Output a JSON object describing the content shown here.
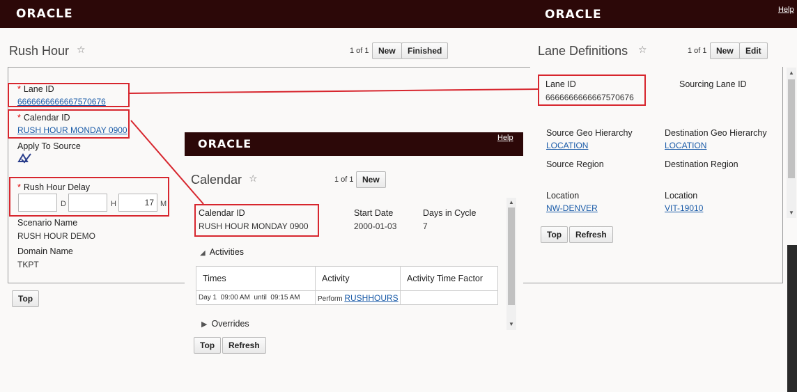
{
  "brand": {
    "logo_left": "ORACLE",
    "logo_right": "ORACLE",
    "help": "Help"
  },
  "rush_hour": {
    "title": "Rush Hour",
    "pager": "1 of 1",
    "new_label": "New",
    "finished_label": "Finished",
    "lane_id_label": "Lane ID",
    "lane_id_value": "6666666666667570676",
    "calendar_id_label": "Calendar ID",
    "calendar_id_value": "RUSH HOUR MONDAY 0900",
    "apply_to_source_label": "Apply To Source",
    "rush_hour_delay_label": "Rush Hour Delay",
    "delay_days": "",
    "delay_hours": "",
    "delay_minutes": "17",
    "unit_d": "D",
    "unit_h": "H",
    "unit_m": "M",
    "scenario_name_label": "Scenario Name",
    "scenario_name_value": "RUSH HOUR DEMO",
    "domain_name_label": "Domain Name",
    "domain_name_value": "TKPT",
    "top_label": "Top",
    "required_mark": "*"
  },
  "lane": {
    "title": "Lane Definitions",
    "pager": "1 of 1",
    "new_label": "New",
    "edit_label": "Edit",
    "lane_id_label": "Lane ID",
    "lane_id_value": "6666666666667570676",
    "sourcing_lane_id_label": "Sourcing Lane ID",
    "source_geo_label": "Source Geo Hierarchy",
    "source_geo_value": "LOCATION",
    "dest_geo_label": "Destination Geo Hierarchy",
    "dest_geo_value": "LOCATION",
    "source_region_label": "Source Region",
    "dest_region_label": "Destination Region",
    "source_location_label": "Location",
    "source_location_value": "NW-DENVER",
    "dest_location_label": "Location",
    "dest_location_value": "VIT-19010",
    "top_label": "Top",
    "refresh_label": "Refresh"
  },
  "calendar": {
    "logo": "ORACLE",
    "help": "Help",
    "title": "Calendar",
    "pager": "1 of 1",
    "new_label": "New",
    "calendar_id_label": "Calendar ID",
    "calendar_id_value": "RUSH HOUR MONDAY 0900",
    "start_date_label": "Start Date",
    "start_date_value": "2000-01-03",
    "days_in_cycle_label": "Days in Cycle",
    "days_in_cycle_value": "7",
    "activities_label": "Activities",
    "columns": [
      "Times",
      "Activity",
      "Activity Time Factor"
    ],
    "row": {
      "times": "Day 1  09:00 AM  until  09:15 AM",
      "activity_prefix": "Perform",
      "activity_link": "RUSHHOURS",
      "factor": ""
    },
    "overrides_label": "Overrides",
    "top_label": "Top",
    "refresh_label": "Refresh"
  },
  "colors": {
    "header_bg": "#2c0808",
    "highlight": "#d7262e",
    "link": "#1a5ba8"
  },
  "icons": {
    "favorite": "star-outline-icon",
    "apply_to_source": "checkmark-icon",
    "expanded": "triangle-down-icon",
    "collapsed": "triangle-right-icon"
  }
}
